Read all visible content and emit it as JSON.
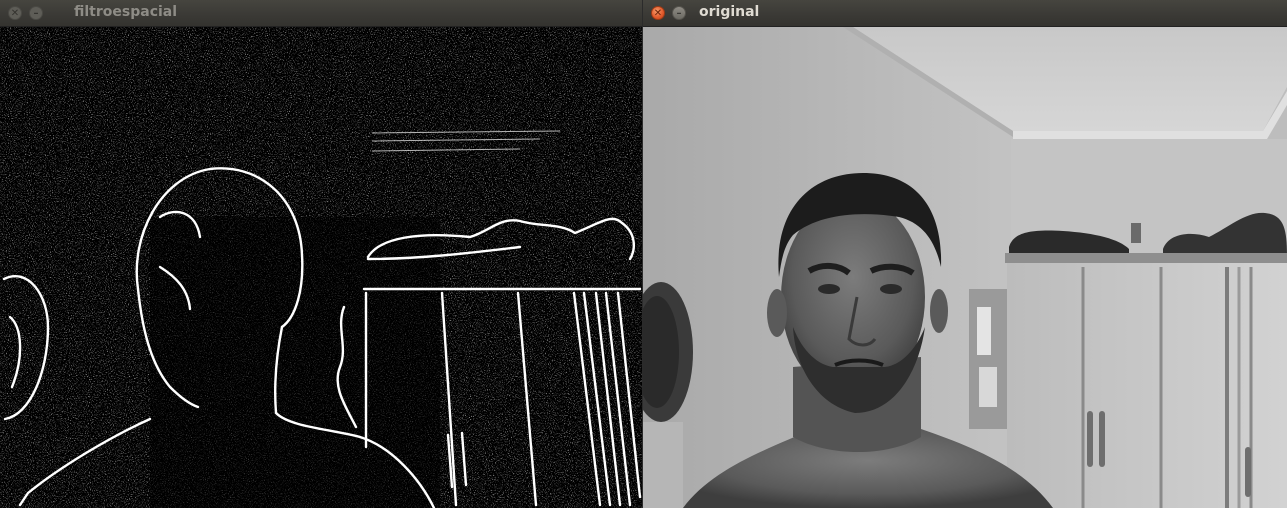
{
  "windows": [
    {
      "title": "filtroespacial",
      "state": "inactive",
      "buttons": {
        "close_icon": "close-icon",
        "minimize_icon": "minimize-icon"
      },
      "content": {
        "type": "edge-detection-filtered-camera-frame"
      }
    },
    {
      "title": "original",
      "state": "active",
      "buttons": {
        "close_icon": "close-icon",
        "minimize_icon": "minimize-icon"
      },
      "content": {
        "type": "grayscale-camera-frame"
      }
    }
  ],
  "colors": {
    "titlebar": "#3c3b37",
    "title_active": "#dfdbd2",
    "title_inactive": "#8e8c86",
    "close_active": "#e2582a"
  }
}
